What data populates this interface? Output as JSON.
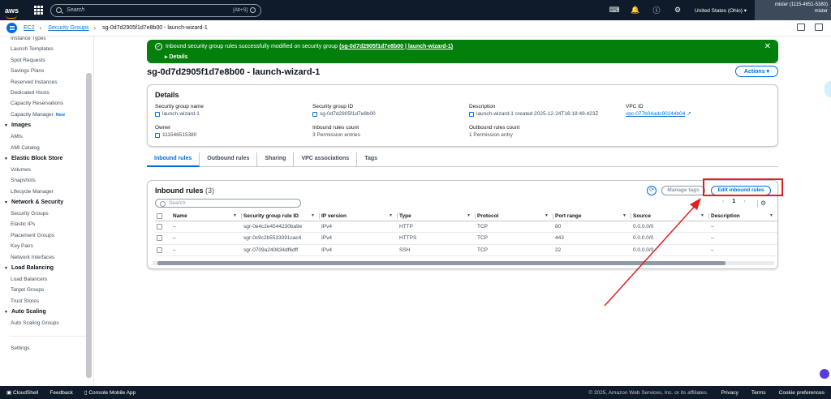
{
  "topnav": {
    "logo": "aws",
    "search_placeholder": "Search",
    "search_shortcut": "[Alt+S]",
    "region": "United States (Ohio)",
    "account": "mister (1115-4651-5380)",
    "user": "mister"
  },
  "breadcrumb": [
    "EC2",
    "Security Groups",
    "sg-0d7d2905f1d7e8b00 - launch-wizard-1"
  ],
  "sidebar": {
    "items_top": [
      "Instance Types",
      "Launch Templates",
      "Spot Requests",
      "Savings Plans",
      "Reserved Instances",
      "Dedicated Hosts",
      "Capacity Reservations",
      "Capacity Manager"
    ],
    "new_badge": "New",
    "images": {
      "title": "Images",
      "items": [
        "AMIs",
        "AMI Catalog"
      ]
    },
    "ebs": {
      "title": "Elastic Block Store",
      "items": [
        "Volumes",
        "Snapshots",
        "Lifecycle Manager"
      ]
    },
    "netsec": {
      "title": "Network & Security",
      "items": [
        "Security Groups",
        "Elastic IPs",
        "Placement Groups",
        "Key Pairs",
        "Network Interfaces"
      ]
    },
    "lb": {
      "title": "Load Balancing",
      "items": [
        "Load Balancers",
        "Target Groups",
        "Trust Stores"
      ]
    },
    "asg": {
      "title": "Auto Scaling",
      "items": [
        "Auto Scaling Groups"
      ]
    },
    "settings": "Settings"
  },
  "flash": {
    "message": "Inbound security group rules successfully modified on security group",
    "link": "(sg-0d7d2905f1d7e8b00 | launch-wizard-1)",
    "details": "Details",
    "status_color": "#037f0c"
  },
  "page_title": "sg-0d7d2905f1d7e8b00 - launch-wizard-1",
  "actions_label": "Actions",
  "details": {
    "title": "Details",
    "sg_name_label": "Security group name",
    "sg_name": "launch-wizard-1",
    "sg_id_label": "Security group ID",
    "sg_id": "sg-0d7d2905f1d7e8b00",
    "desc_label": "Description",
    "desc": "launch-wizard-1 created 2025-12-24T16:18:49.423Z",
    "vpc_label": "VPC ID",
    "vpc": "vpc-077b04adc90244b04",
    "owner_label": "Owner",
    "owner": "111546515380",
    "inbound_count_label": "Inbound rules count",
    "inbound_count": "3 Permission entries",
    "outbound_count_label": "Outbound rules count",
    "outbound_count": "1 Permission entry"
  },
  "tabs": [
    "Inbound rules",
    "Outbound rules",
    "Sharing",
    "VPC associations",
    "Tags"
  ],
  "rules": {
    "title": "Inbound rules",
    "count": "(3)",
    "manage_tags": "Manage tags",
    "edit_label": "Edit inbound rules",
    "search_placeholder": "Search",
    "page": "1",
    "columns": [
      "Name",
      "Security group rule ID",
      "IP version",
      "Type",
      "Protocol",
      "Port range",
      "Source",
      "Description"
    ],
    "rows": [
      [
        "–",
        "sgr-0e4c2e4544230ba9e",
        "IPv4",
        "HTTP",
        "TCP",
        "80",
        "0.0.0.0/0",
        "–"
      ],
      [
        "–",
        "sgr-0c9c2b5533091cac4",
        "IPv4",
        "HTTPS",
        "TCP",
        "443",
        "0.0.0.0/0",
        "–"
      ],
      [
        "–",
        "sgr-0709a240834df6dff",
        "IPv4",
        "SSH",
        "TCP",
        "22",
        "0.0.0.0/0",
        "–"
      ]
    ]
  },
  "footer": {
    "cloudshell": "CloudShell",
    "feedback": "Feedback",
    "mobile": "Console Mobile App",
    "copyright": "© 2025, Amazon Web Services, Inc. or its affiliates.",
    "privacy": "Privacy",
    "terms": "Terms",
    "cookies": "Cookie preferences"
  }
}
